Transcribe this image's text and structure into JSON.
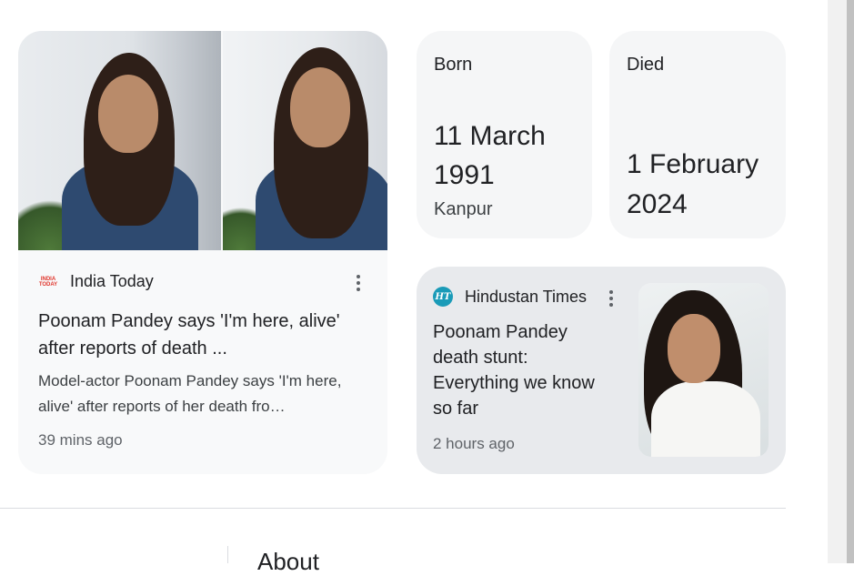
{
  "news_card_1": {
    "source": "India Today",
    "logo_text": "INDIA TODAY",
    "title": "Poonam Pandey says 'I'm here, alive' after reports of death ...",
    "snippet": "Model-actor Poonam Pandey says 'I'm here, alive' after reports of her death fro…",
    "time": "39 mins ago"
  },
  "born": {
    "label": "Born",
    "date_line1": "11 March",
    "date_line2": "1991",
    "place": "Kanpur"
  },
  "died": {
    "label": "Died",
    "date_line1": "1 February",
    "date_line2": "2024"
  },
  "news_card_2": {
    "source": "Hindustan Times",
    "logo_text": "HT",
    "title_lines": [
      "Poonam Pandey",
      "death stunt:",
      "Everything we know",
      "so far"
    ],
    "time": "2 hours ago"
  },
  "section": {
    "about_heading": "About"
  },
  "colors": {
    "card_bg": "#f8f9fa",
    "card_bg_dark": "#e8eaed",
    "ht_logo": "#1a9bb8",
    "it_logo": "#e0352b"
  }
}
